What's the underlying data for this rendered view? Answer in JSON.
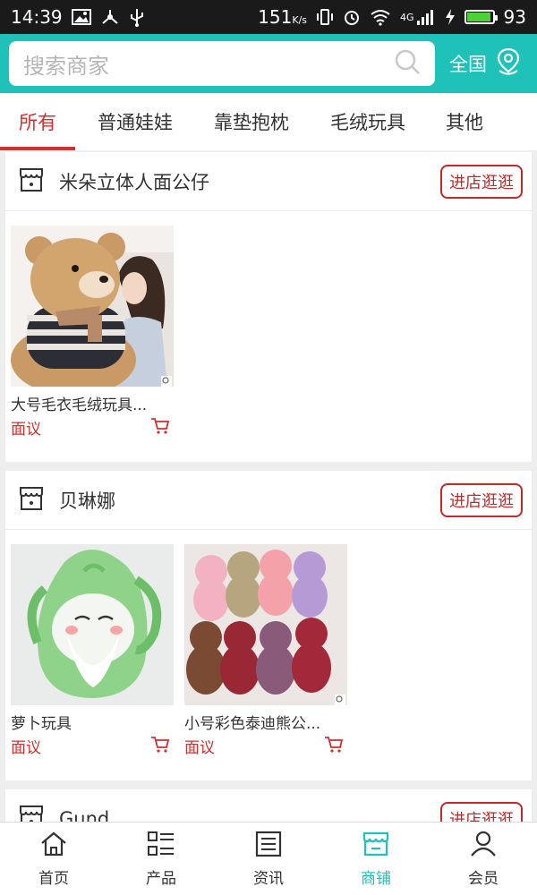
{
  "status_bar": {
    "time": "14:39",
    "speed": "151",
    "speed_unit": "K/s",
    "network": "4G",
    "battery": "93",
    "battery_level": 0.93
  },
  "search": {
    "placeholder": "搜索商家"
  },
  "region": {
    "label": "全国"
  },
  "tabs": [
    {
      "label": "所有",
      "active": true
    },
    {
      "label": "普通娃娃"
    },
    {
      "label": "靠垫抱枕"
    },
    {
      "label": "毛绒玩具"
    },
    {
      "label": "其他"
    }
  ],
  "shops": [
    {
      "name": "米朵立体人面公仔",
      "visit_label": "进店逛逛",
      "products": [
        {
          "name": "大号毛衣毛绒玩具...",
          "price": "面议"
        }
      ]
    },
    {
      "name": "贝琳娜",
      "visit_label": "进店逛逛",
      "products": [
        {
          "name": "萝卜玩具",
          "price": "面议"
        },
        {
          "name": "小号彩色泰迪熊公...",
          "price": "面议"
        }
      ]
    },
    {
      "name": "Gund",
      "visit_label": "进店逛逛",
      "products": []
    }
  ],
  "bottom_nav": [
    {
      "label": "首页",
      "icon": "home-icon"
    },
    {
      "label": "产品",
      "icon": "product-list-icon"
    },
    {
      "label": "资讯",
      "icon": "news-icon"
    },
    {
      "label": "商铺",
      "icon": "shop-icon",
      "active": true
    },
    {
      "label": "会员",
      "icon": "member-icon"
    }
  ],
  "colors": {
    "accent": "#1ec2b8",
    "price_red": "#d32f2f",
    "button_red": "#c62828"
  }
}
